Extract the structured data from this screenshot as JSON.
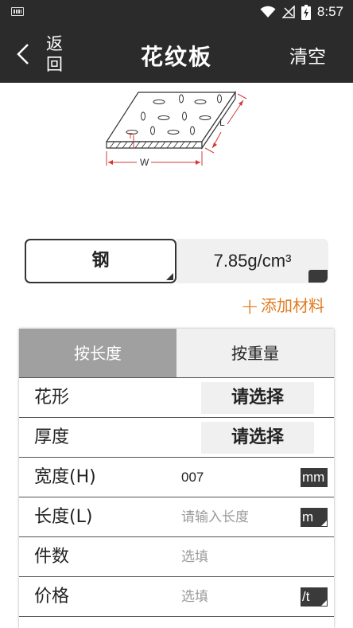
{
  "status": {
    "time": "8:57"
  },
  "header": {
    "back_label": "返回",
    "title": "花纹板",
    "clear_label": "清空"
  },
  "diagram": {
    "label_t": "T",
    "label_l": "L",
    "label_w": "W"
  },
  "material": {
    "name": "钢",
    "density": "7.85g/cm³"
  },
  "add_material_label": "添加材料",
  "tabs": [
    {
      "label": "按长度",
      "active": true
    },
    {
      "label": "按重量",
      "active": false
    }
  ],
  "rows": {
    "pattern": {
      "label": "花形",
      "value": "请选择"
    },
    "thickness": {
      "label": "厚度",
      "value": "请选择"
    },
    "width": {
      "label": "宽度(H)",
      "value": "007",
      "unit": "mm"
    },
    "length": {
      "label": "长度(L)",
      "placeholder": "请输入长度",
      "unit": "m"
    },
    "count": {
      "label": "件数",
      "placeholder": "选填"
    },
    "price": {
      "label": "价格",
      "placeholder": "选填",
      "unit": "/t"
    }
  },
  "colors": {
    "bar": "#2b2b2b",
    "accent": "#e07b1f",
    "diagram_red": "#d43a3a",
    "tab_active": "#a0a0a0"
  }
}
